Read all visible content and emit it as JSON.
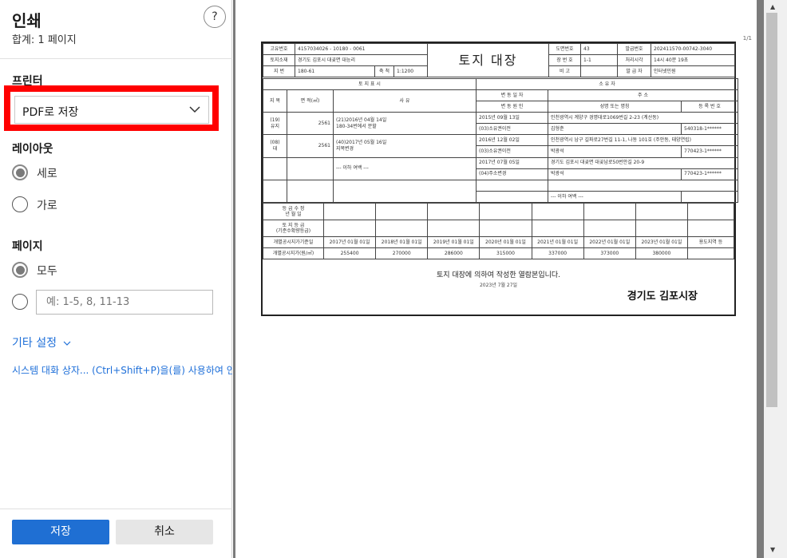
{
  "panel": {
    "title": "인쇄",
    "subtitle": "합계: 1 페이지",
    "help": "?",
    "printer_label": "프린터",
    "destination": "PDF로 저장",
    "layout_label": "레이아웃",
    "layout_options": [
      {
        "label": "세로",
        "selected": true
      },
      {
        "label": "가로",
        "selected": false
      }
    ],
    "pages_label": "페이지",
    "pages_options": [
      {
        "label": "모두",
        "selected": true
      },
      {
        "label": "",
        "selected": false
      }
    ],
    "pages_placeholder": "예: 1-5, 8, 11-13",
    "more_settings": "기타 설정",
    "system_dialog": "시스템 대화 상자... (Ctrl+Shift+P)을(를) 사용하여 인쇄",
    "save_button": "저장",
    "cancel_button": "취소",
    "highlight_color": "#ff0000",
    "accent_color": "#1f6fd3"
  },
  "preview": {
    "page_number": "1/1"
  },
  "doc": {
    "title": "토지 대장",
    "header": {
      "r1": {
        "l1": "고유번호",
        "v1": "4157034026 - 10180 - 0061",
        "l2": "도면번호",
        "v2": "43",
        "l3": "발급번호",
        "v3": "202411570-00742-3040"
      },
      "r2": {
        "l1": "토지소재",
        "v1": "경기도 김포시 대곶면 대능리",
        "l2": "장 번 호",
        "v2": "1-1",
        "l3": "처리시각",
        "v3": "14시 40분 19초"
      },
      "r3": {
        "l1": "지  번",
        "v1": "180-61",
        "l1b": "축  척",
        "v1b": "1:1200",
        "l2": "비  고",
        "v2": "",
        "l3": "발 급 자",
        "v3": "인터넷민원"
      }
    },
    "section_left": "토 지 표 시",
    "section_right": "소 유 자",
    "col_jimok": "지 목",
    "col_area": "면 적(㎡)",
    "col_reason": "사  유",
    "col_change_date": "변 동 일 자",
    "col_change_cause": "변 동 원 인",
    "col_address": "주  소",
    "col_name": "성명 또는 명칭",
    "col_regno": "등 록 번 호",
    "land_rows": [
      {
        "code": "(19)",
        "jimok": "유지",
        "area": "2561",
        "reason1": "(21)2016년 04월 14일",
        "reason2": "180-34번에서 분할"
      },
      {
        "code": "(08)",
        "jimok": "대",
        "area": "2561",
        "reason1": "(40)2017년 05월 16일",
        "reason2": "지목변경"
      },
      {
        "code": "",
        "jimok": "",
        "area": "",
        "reason1": "--- 이하 여백 ---",
        "reason2": ""
      }
    ],
    "owner_rows": [
      {
        "date": "2015년 09월 13일",
        "cause": "(03)소유권이전",
        "addr": "인천광역시 계양구 경명대로1069번길 2-23 (계산동)",
        "name": "김형춘",
        "reg": "540318-1******"
      },
      {
        "date": "2016년 12월 02일",
        "cause": "(03)소유권이전",
        "addr": "인천광역시 남구 길파로27번길 11-1, 나동 101호 (주안동, 태양연립)",
        "name": "박광석",
        "reg": "770423-1******"
      },
      {
        "date": "2017년 07월 05일",
        "cause": "(04)주소변경",
        "addr": "경기도 김포시 대곶면 대곶남로50번안길 20-9",
        "name": "박광석",
        "reg": "770423-1******"
      },
      {
        "date": "",
        "cause": "",
        "addr": "",
        "name": "--- 이하 여백 ---",
        "reg": ""
      }
    ],
    "grade_label1": "등 급 수 정",
    "grade_label2": "년 월 일",
    "grade_label3": "토 지 등 급",
    "grade_label4": "(기준수확량등급)",
    "price_years_label": "개별공시지가기준일",
    "price_years": [
      "2017년 01월 01일",
      "2018년 01월 01일",
      "2019년 01월 01일",
      "2020년 01월 01일",
      "2021년 01월 01일",
      "2022년 01월 01일",
      "2023년 01월 01일"
    ],
    "zoning_label": "용도지역 등",
    "price_label": "개별공시지가(원/㎡)",
    "prices": [
      "255400",
      "270000",
      "286000",
      "315000",
      "337000",
      "373000",
      "380000"
    ],
    "footer_text": "토지 대장에 의하여 작성한 열람본입니다.",
    "footer_date": "2023년 7월 27일",
    "issuer": "경기도 김포시장"
  }
}
